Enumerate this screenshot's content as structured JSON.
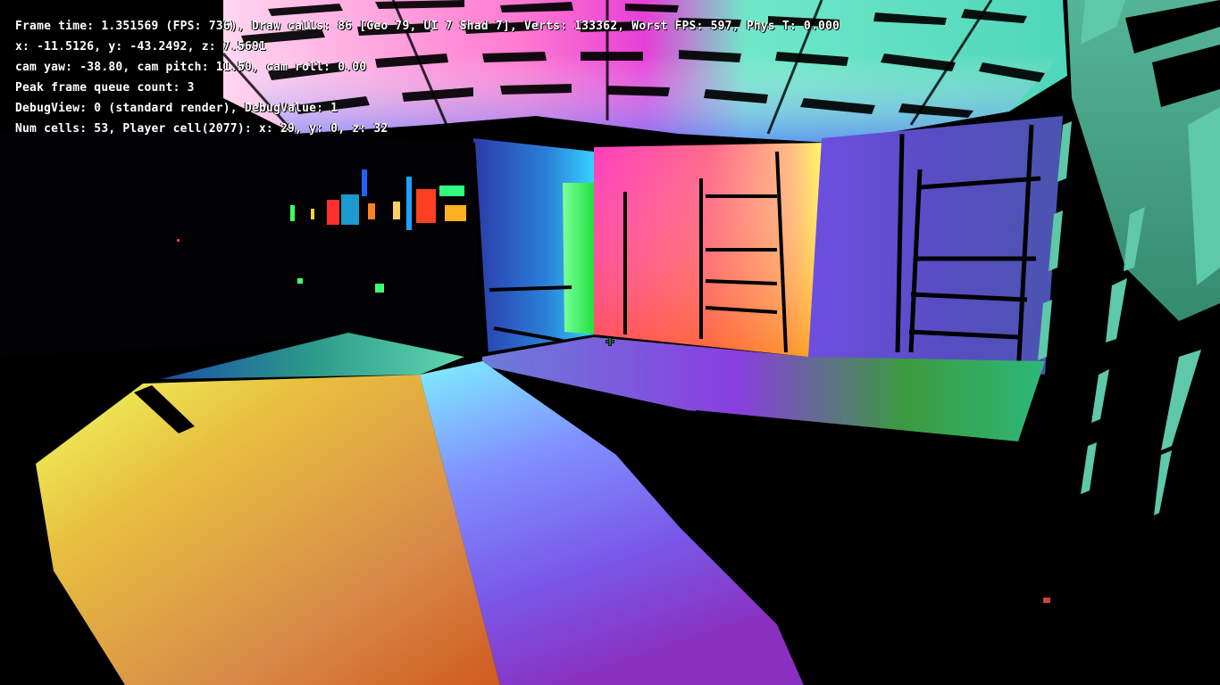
{
  "hud": {
    "lines": [
      "Frame time: 1.351569 (FPS: 736), Draw calls: 86 [Geo 79, UI 7 Shad 7], Verts: 133362, Worst FPS: 597, Phys T: 0.000",
      "x: -11.5126, y: -43.2492, z: 7.5691",
      "cam yaw: -38.80, cam pitch: 11.50, cam roll: 0.00",
      "Peak frame queue count: 3",
      "DebugView: 0 (standard render), DebugValue: 1",
      "Num cells: 53, Player cell(2077): x: 29, y: 0, z: 32"
    ]
  },
  "colors": {
    "background": "#000000",
    "hud_text": "#ffffff",
    "crosshair": "#2f6a3a"
  },
  "icons": {
    "crosshair": "crosshair-icon"
  }
}
